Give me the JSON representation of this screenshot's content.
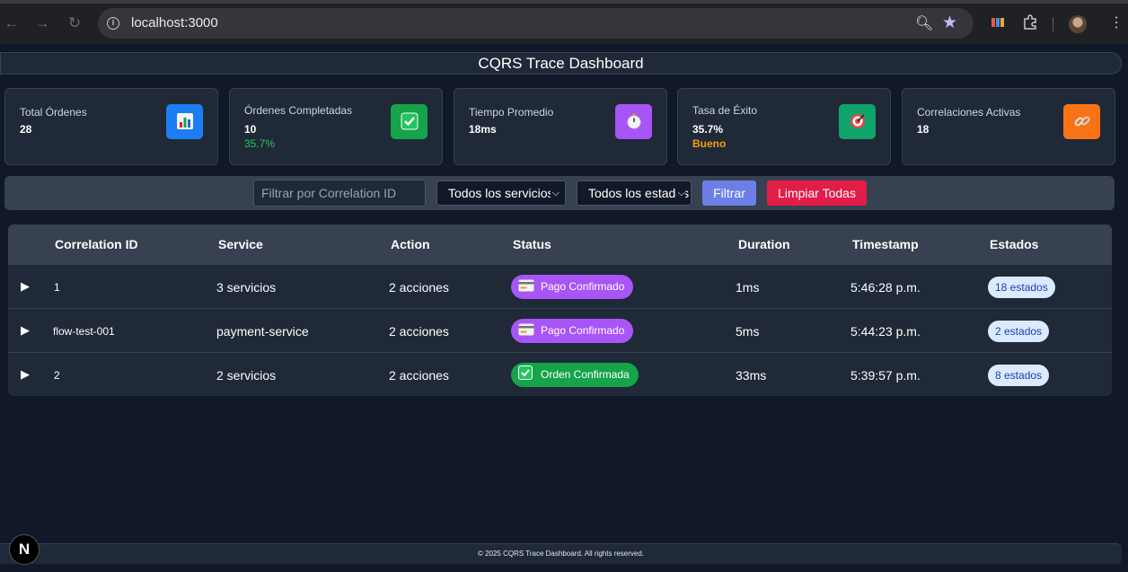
{
  "browser": {
    "url": "localhost:3000",
    "back_icon": "arrow-left-icon",
    "forward_icon": "arrow-right-icon",
    "reload_icon": "reload-icon"
  },
  "header": {
    "title": "CQRS Trace Dashboard"
  },
  "stats": [
    {
      "label": "Total Órdenes",
      "value": "28",
      "sub": "",
      "icon": "bar-chart-icon",
      "color": "#1d7df3"
    },
    {
      "label": "Órdenes Completadas",
      "value": "10",
      "sub": "35.7%",
      "sub_color": "#22c55e",
      "icon": "check-mark-icon",
      "color": "#16a34a"
    },
    {
      "label": "Tiempo Promedio",
      "value": "18ms",
      "sub": "",
      "icon": "stopwatch-icon",
      "color": "#a855f7"
    },
    {
      "label": "Tasa de Éxito",
      "value": "35.7%",
      "sub": "Bueno",
      "sub_color": "#f59e0b",
      "icon": "target-icon",
      "color": "#10a36a"
    },
    {
      "label": "Correlaciones Activas",
      "value": "18",
      "sub": "",
      "icon": "link-icon",
      "color": "#f97316"
    }
  ],
  "filters": {
    "correlation_placeholder": "Filtrar por Correlation ID",
    "service_selected": "Todos los servicios",
    "status_selected": "Todos los estados",
    "filter_button": "Filtrar",
    "clear_button": "Limpiar Todas"
  },
  "table": {
    "columns": [
      "Correlation ID",
      "Service",
      "Action",
      "Status",
      "Duration",
      "Timestamp",
      "Estados"
    ],
    "rows": [
      {
        "id": "1",
        "service": "3 servicios",
        "action": "2 acciones",
        "status": "Pago Confirmado",
        "status_icon": "credit-card-icon",
        "status_color": "#a855f7",
        "duration": "1ms",
        "timestamp": "5:46:28 p.m.",
        "estados": "18 estados"
      },
      {
        "id": "flow-test-001",
        "service": "payment-service",
        "action": "2 acciones",
        "status": "Pago Confirmado",
        "status_icon": "credit-card-icon",
        "status_color": "#a855f7",
        "duration": "5ms",
        "timestamp": "5:44:23 p.m.",
        "estados": "2 estados"
      },
      {
        "id": "2",
        "service": "2 servicios",
        "action": "2 acciones",
        "status": "Orden Confirmada",
        "status_icon": "check-mark-icon",
        "status_color": "#16a34a",
        "duration": "33ms",
        "timestamp": "5:39:57 p.m.",
        "estados": "8 estados"
      }
    ]
  },
  "footer": {
    "text": "© 2025 CQRS Trace Dashboard. All rights reserved."
  },
  "next_badge": "N"
}
